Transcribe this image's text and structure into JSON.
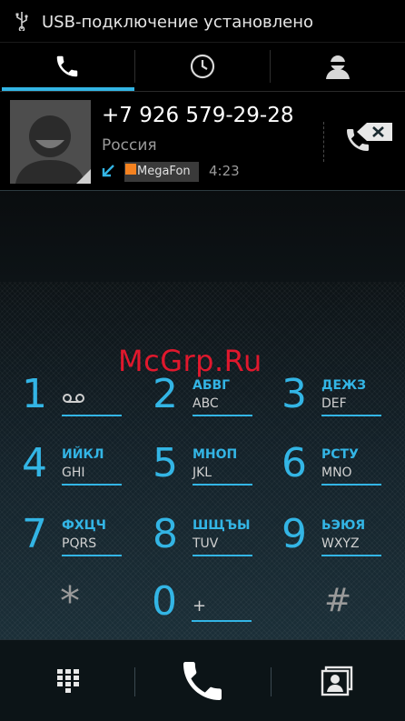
{
  "status_bar": {
    "usb_text": "USB-подключение установлено",
    "icon": "usb-icon"
  },
  "tabs": [
    {
      "name": "phone",
      "icon": "phone-icon",
      "selected": true
    },
    {
      "name": "recent",
      "icon": "clock-icon",
      "selected": false
    },
    {
      "name": "contacts",
      "icon": "person-icon",
      "selected": false
    }
  ],
  "recent_call": {
    "number": "+7 926 579-29-28",
    "country": "Россия",
    "call_type_icon": "incoming-call-arrow-icon",
    "operator": "MegaFon",
    "duration": "4:23"
  },
  "keypad": {
    "keys": [
      {
        "digit": "1",
        "ru": "",
        "lat": ""
      },
      {
        "digit": "2",
        "ru": "АБВГ",
        "lat": "ABC"
      },
      {
        "digit": "3",
        "ru": "ДЕЖЗ",
        "lat": "DEF"
      },
      {
        "digit": "4",
        "ru": "ИЙКЛ",
        "lat": "GHI"
      },
      {
        "digit": "5",
        "ru": "МНОП",
        "lat": "JKL"
      },
      {
        "digit": "6",
        "ru": "РСТУ",
        "lat": "MNO"
      },
      {
        "digit": "7",
        "ru": "ФХЦЧ",
        "lat": "PQRS"
      },
      {
        "digit": "8",
        "ru": "ШЩЪЫ",
        "lat": "TUV"
      },
      {
        "digit": "9",
        "ru": "ЬЭЮЯ",
        "lat": "WXYZ"
      }
    ],
    "star": "*",
    "zero": "0",
    "zero_sub": "+",
    "hash": "#"
  },
  "watermark": "McGrp.Ru",
  "colors": {
    "accent": "#33b5e5",
    "watermark": "#e0182d"
  },
  "bottom_bar": {
    "left_icon": "dialpad-icon",
    "center_icon": "call-icon",
    "right_icon": "contact-card-icon"
  }
}
